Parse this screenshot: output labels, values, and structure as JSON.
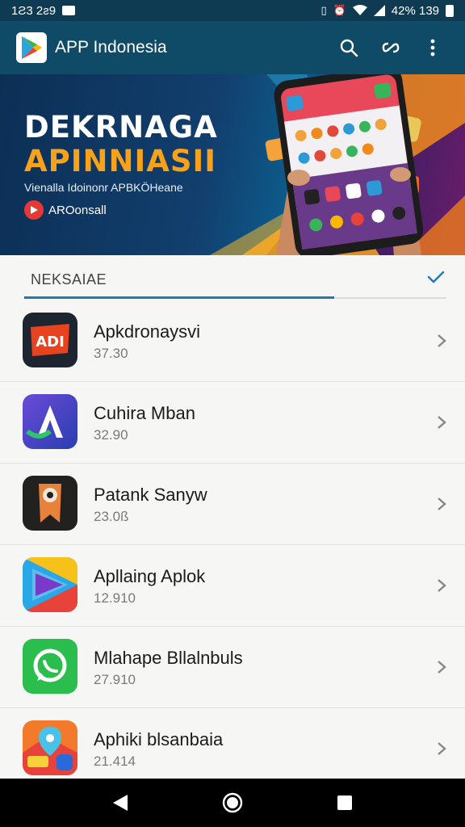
{
  "status_bar": {
    "left_time": "1Ƨ3 2ƨ9",
    "right_text": "42% 139",
    "icons": [
      "notification-icon",
      "vibrate-icon",
      "alarm-icon",
      "wifi-icon",
      "signal-icon",
      "battery-icon"
    ]
  },
  "app_bar": {
    "title": "APP Indonesia",
    "icons": [
      "play-logo-icon",
      "search-icon",
      "link-icon",
      "more-vert-icon"
    ]
  },
  "banner": {
    "title_line1": "DEKRNAGA",
    "title_line2": "APINNIASII",
    "subtitle": "Vienalla Idoinonr APBKÖHeane",
    "brand_label": "AROonsall",
    "colors": {
      "title1": "#ffffff",
      "title2": "#f7a21a",
      "background": "#0f3c63"
    }
  },
  "section": {
    "title": "NEKSAIAE",
    "icon": "check-icon"
  },
  "apps": [
    {
      "name": "Apkdronaysvi",
      "meta": "37.30",
      "icon": "apkd-app-icon"
    },
    {
      "name": "Cuhira Mban",
      "meta": "32.90",
      "icon": "a-letter-app-icon"
    },
    {
      "name": "Patank Sanyw",
      "meta": "23.0ß",
      "icon": "mascot-app-icon"
    },
    {
      "name": "Apllaing Aplok",
      "meta": "12.910",
      "icon": "play-arrow-app-icon"
    },
    {
      "name": "Mlahape Bllalnbuls",
      "meta": "27.910",
      "icon": "chat-bubble-app-icon"
    },
    {
      "name": "Aphiki blsanbaia",
      "meta": "21.414",
      "icon": "map-app-icon"
    }
  ],
  "nav_bar": {
    "icons": [
      "back-icon",
      "home-icon",
      "recents-icon"
    ]
  },
  "colors": {
    "app_bar": "#0f4a67",
    "status_bar": "#0e3a52",
    "accent": "#1f7ab8",
    "list_bg": "#f6f6f4"
  }
}
